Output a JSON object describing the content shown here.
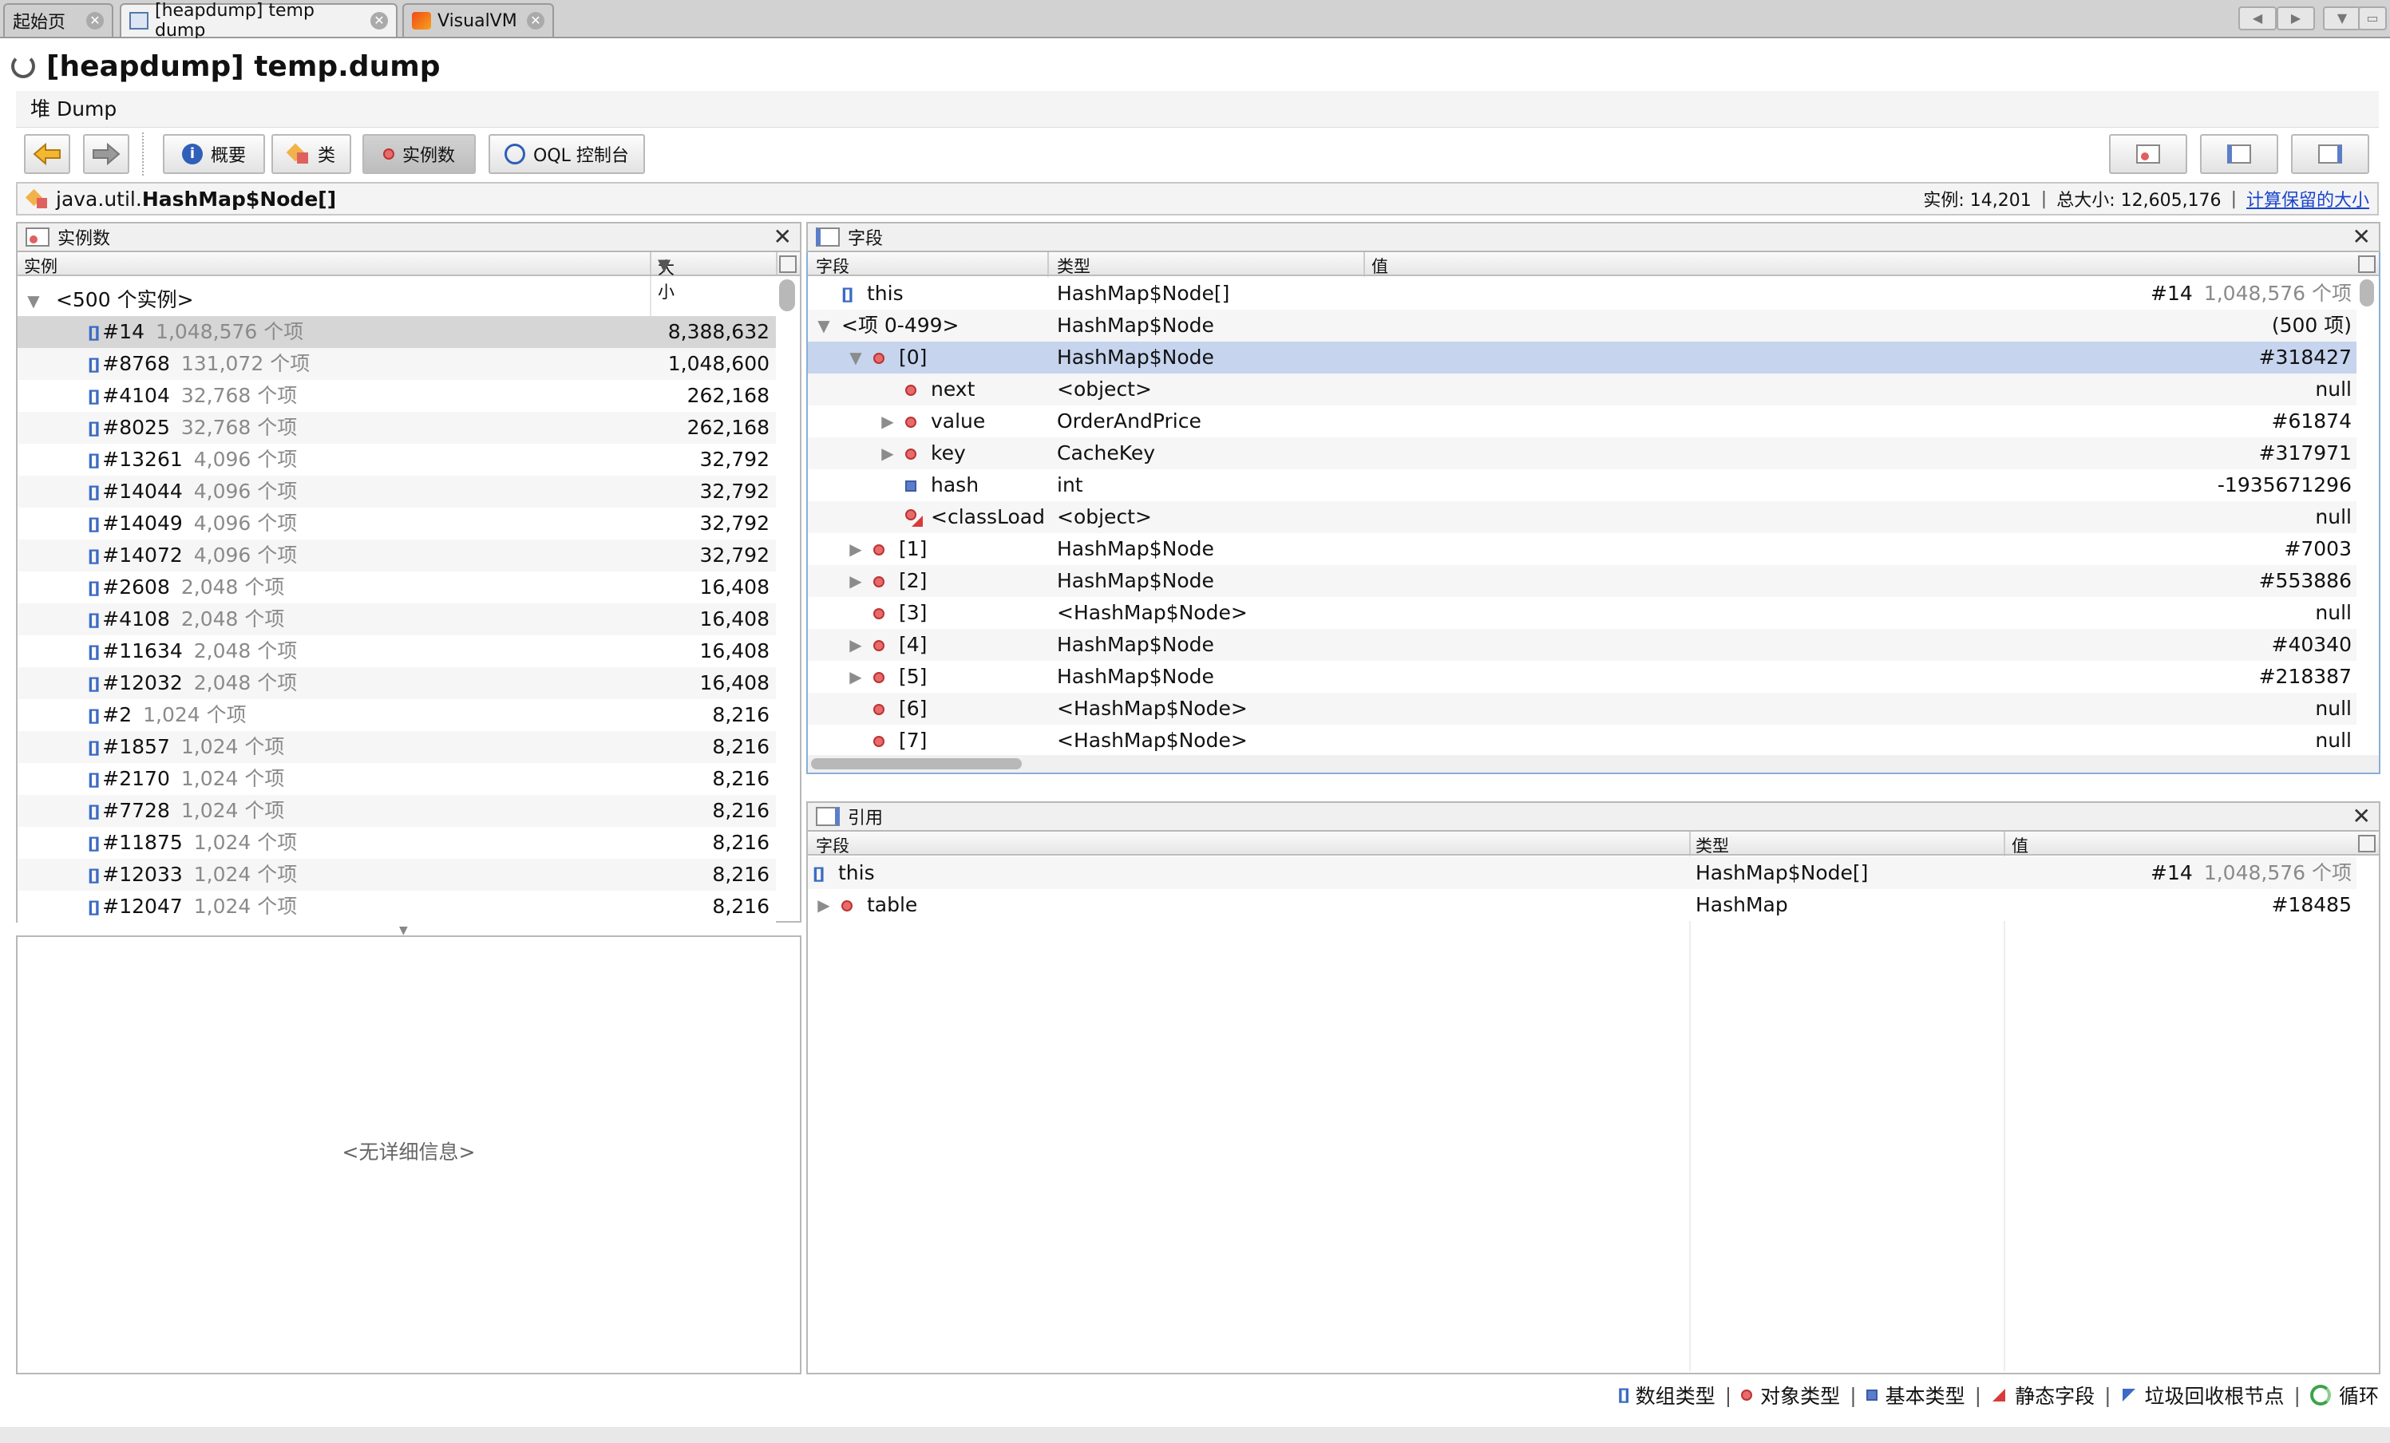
{
  "tabs": [
    {
      "label": "起始页"
    },
    {
      "label": "[heapdump] temp dump"
    },
    {
      "label": "VisualVM"
    }
  ],
  "title": "[heapdump] temp.dump",
  "subtitle": "堆 Dump",
  "toolbar": {
    "overview_label": "概要",
    "classes_label": "类",
    "instances_label": "实例数",
    "oql_label": "OQL 控制台"
  },
  "classbar": {
    "package": "java.util.",
    "class_name": "HashMap$Node[]",
    "instances_text": "实例: 14,201",
    "total_size_text": "总大小: 12,605,176",
    "retained_link": "计算保留的大小"
  },
  "instances_panel": {
    "title": "实例数",
    "col_instance": "实例",
    "col_size": "大小",
    "group_label": "<500 个实例>",
    "rows": [
      {
        "id": "#14",
        "items": "1,048,576 个项",
        "size": "8,388,632"
      },
      {
        "id": "#8768",
        "items": "131,072 个项",
        "size": "1,048,600"
      },
      {
        "id": "#4104",
        "items": "32,768 个项",
        "size": "262,168"
      },
      {
        "id": "#8025",
        "items": "32,768 个项",
        "size": "262,168"
      },
      {
        "id": "#13261",
        "items": "4,096 个项",
        "size": "32,792"
      },
      {
        "id": "#14044",
        "items": "4,096 个项",
        "size": "32,792"
      },
      {
        "id": "#14049",
        "items": "4,096 个项",
        "size": "32,792"
      },
      {
        "id": "#14072",
        "items": "4,096 个项",
        "size": "32,792"
      },
      {
        "id": "#2608",
        "items": "2,048 个项",
        "size": "16,408"
      },
      {
        "id": "#4108",
        "items": "2,048 个项",
        "size": "16,408"
      },
      {
        "id": "#11634",
        "items": "2,048 个项",
        "size": "16,408"
      },
      {
        "id": "#12032",
        "items": "2,048 个项",
        "size": "16,408"
      },
      {
        "id": "#2",
        "items": "1,024 个项",
        "size": "8,216"
      },
      {
        "id": "#1857",
        "items": "1,024 个项",
        "size": "8,216"
      },
      {
        "id": "#2170",
        "items": "1,024 个项",
        "size": "8,216"
      },
      {
        "id": "#7728",
        "items": "1,024 个项",
        "size": "8,216"
      },
      {
        "id": "#11875",
        "items": "1,024 个项",
        "size": "8,216"
      },
      {
        "id": "#12033",
        "items": "1,024 个项",
        "size": "8,216"
      },
      {
        "id": "#12047",
        "items": "1,024 个项",
        "size": "8,216"
      }
    ],
    "no_details": "<无详细信息>"
  },
  "fields_panel": {
    "title": "字段",
    "col_field": "字段",
    "col_type": "类型",
    "col_value": "值",
    "rows": [
      {
        "level": 0,
        "expander": "",
        "icon": "array",
        "name": "this",
        "type": "HashMap$Node[]",
        "value": "#14",
        "value_extra": "1,048,576 个项"
      },
      {
        "level": 0,
        "expander": "▼",
        "icon": "",
        "name": "<项 0-499>",
        "type": "HashMap$Node",
        "value": "(500 项)",
        "value_extra": ""
      },
      {
        "level": 1,
        "expander": "▼",
        "icon": "object",
        "name": "[0]",
        "type": "HashMap$Node",
        "value": "#318427",
        "value_extra": "",
        "selected": true
      },
      {
        "level": 2,
        "expander": "",
        "icon": "object",
        "name": "next",
        "type": "<object>",
        "value": "null",
        "value_extra": ""
      },
      {
        "level": 2,
        "expander": "▶",
        "icon": "object",
        "name": "value",
        "type": "OrderAndPrice",
        "value": "#61874",
        "value_extra": ""
      },
      {
        "level": 2,
        "expander": "▶",
        "icon": "object",
        "name": "key",
        "type": "CacheKey",
        "value": "#317971",
        "value_extra": ""
      },
      {
        "level": 2,
        "expander": "",
        "icon": "primitive",
        "name": "hash",
        "type": "int",
        "value": "-1935671296",
        "value_extra": ""
      },
      {
        "level": 2,
        "expander": "",
        "icon": "static",
        "name": "<classLoad",
        "type": "<object>",
        "value": "null",
        "value_extra": ""
      },
      {
        "level": 1,
        "expander": "▶",
        "icon": "object",
        "name": "[1]",
        "type": "HashMap$Node",
        "value": "#7003",
        "value_extra": ""
      },
      {
        "level": 1,
        "expander": "▶",
        "icon": "object",
        "name": "[2]",
        "type": "HashMap$Node",
        "value": "#553886",
        "value_extra": ""
      },
      {
        "level": 1,
        "expander": "",
        "icon": "object",
        "name": "[3]",
        "type": "<HashMap$Node>",
        "value": "null",
        "value_extra": ""
      },
      {
        "level": 1,
        "expander": "▶",
        "icon": "object",
        "name": "[4]",
        "type": "HashMap$Node",
        "value": "#40340",
        "value_extra": ""
      },
      {
        "level": 1,
        "expander": "▶",
        "icon": "object",
        "name": "[5]",
        "type": "HashMap$Node",
        "value": "#218387",
        "value_extra": ""
      },
      {
        "level": 1,
        "expander": "",
        "icon": "object",
        "name": "[6]",
        "type": "<HashMap$Node>",
        "value": "null",
        "value_extra": ""
      },
      {
        "level": 1,
        "expander": "",
        "icon": "object",
        "name": "[7]",
        "type": "<HashMap$Node>",
        "value": "null",
        "value_extra": ""
      }
    ]
  },
  "refs_panel": {
    "title": "引用",
    "col_field": "字段",
    "col_type": "类型",
    "col_value": "值",
    "rows": [
      {
        "expander": "",
        "icon": "array",
        "name": "this",
        "type": "HashMap$Node[]",
        "value": "#14",
        "value_extra": "1,048,576 个项"
      },
      {
        "expander": "▶",
        "icon": "object",
        "name": "table",
        "type": "HashMap",
        "value": "#18485",
        "value_extra": ""
      }
    ]
  },
  "legend": [
    {
      "icon": "array",
      "label": "数组类型"
    },
    {
      "icon": "object",
      "label": "对象类型"
    },
    {
      "icon": "primitive",
      "label": "基本类型"
    },
    {
      "icon": "static",
      "label": "静态字段"
    },
    {
      "icon": "gcroot",
      "label": "垃圾回收根节点"
    },
    {
      "icon": "loop",
      "label": "循环"
    }
  ],
  "colors": {
    "selected_row": "#c6d4ee",
    "instance_selected": "#d6d6d6",
    "link": "#1a44cc"
  }
}
